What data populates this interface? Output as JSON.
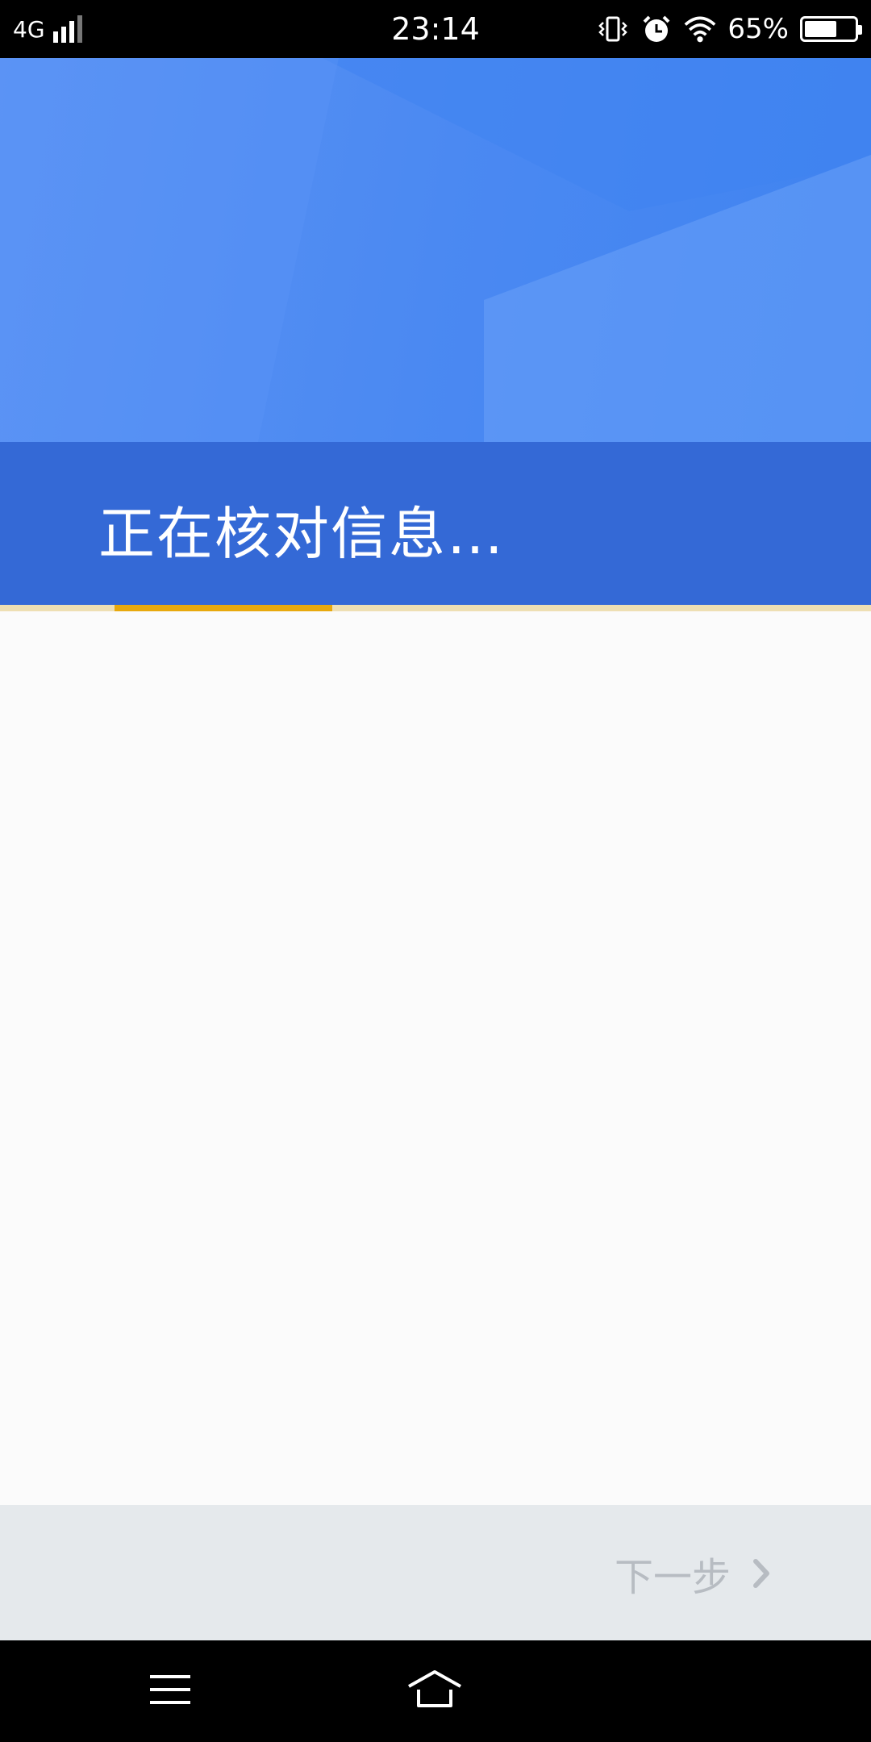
{
  "status_bar": {
    "network": "4G",
    "time": "23:14",
    "battery_percent": "65%",
    "battery_level": 0.65,
    "icons": [
      "signal-icon",
      "vibrate-icon",
      "alarm-icon",
      "wifi-icon",
      "battery-icon"
    ]
  },
  "header": {
    "title": "正在核对信息…",
    "background_color": "#3f83f0",
    "band_color": "#3469d6"
  },
  "progress": {
    "value": 0.25,
    "fill_color": "#e8a90e",
    "track_color": "#eedfb3"
  },
  "footer": {
    "next_label": "下一步",
    "next_icon": "chevron-right-icon",
    "next_enabled": false
  },
  "nav_bar": {
    "icons": [
      "menu-icon",
      "home-icon"
    ]
  }
}
